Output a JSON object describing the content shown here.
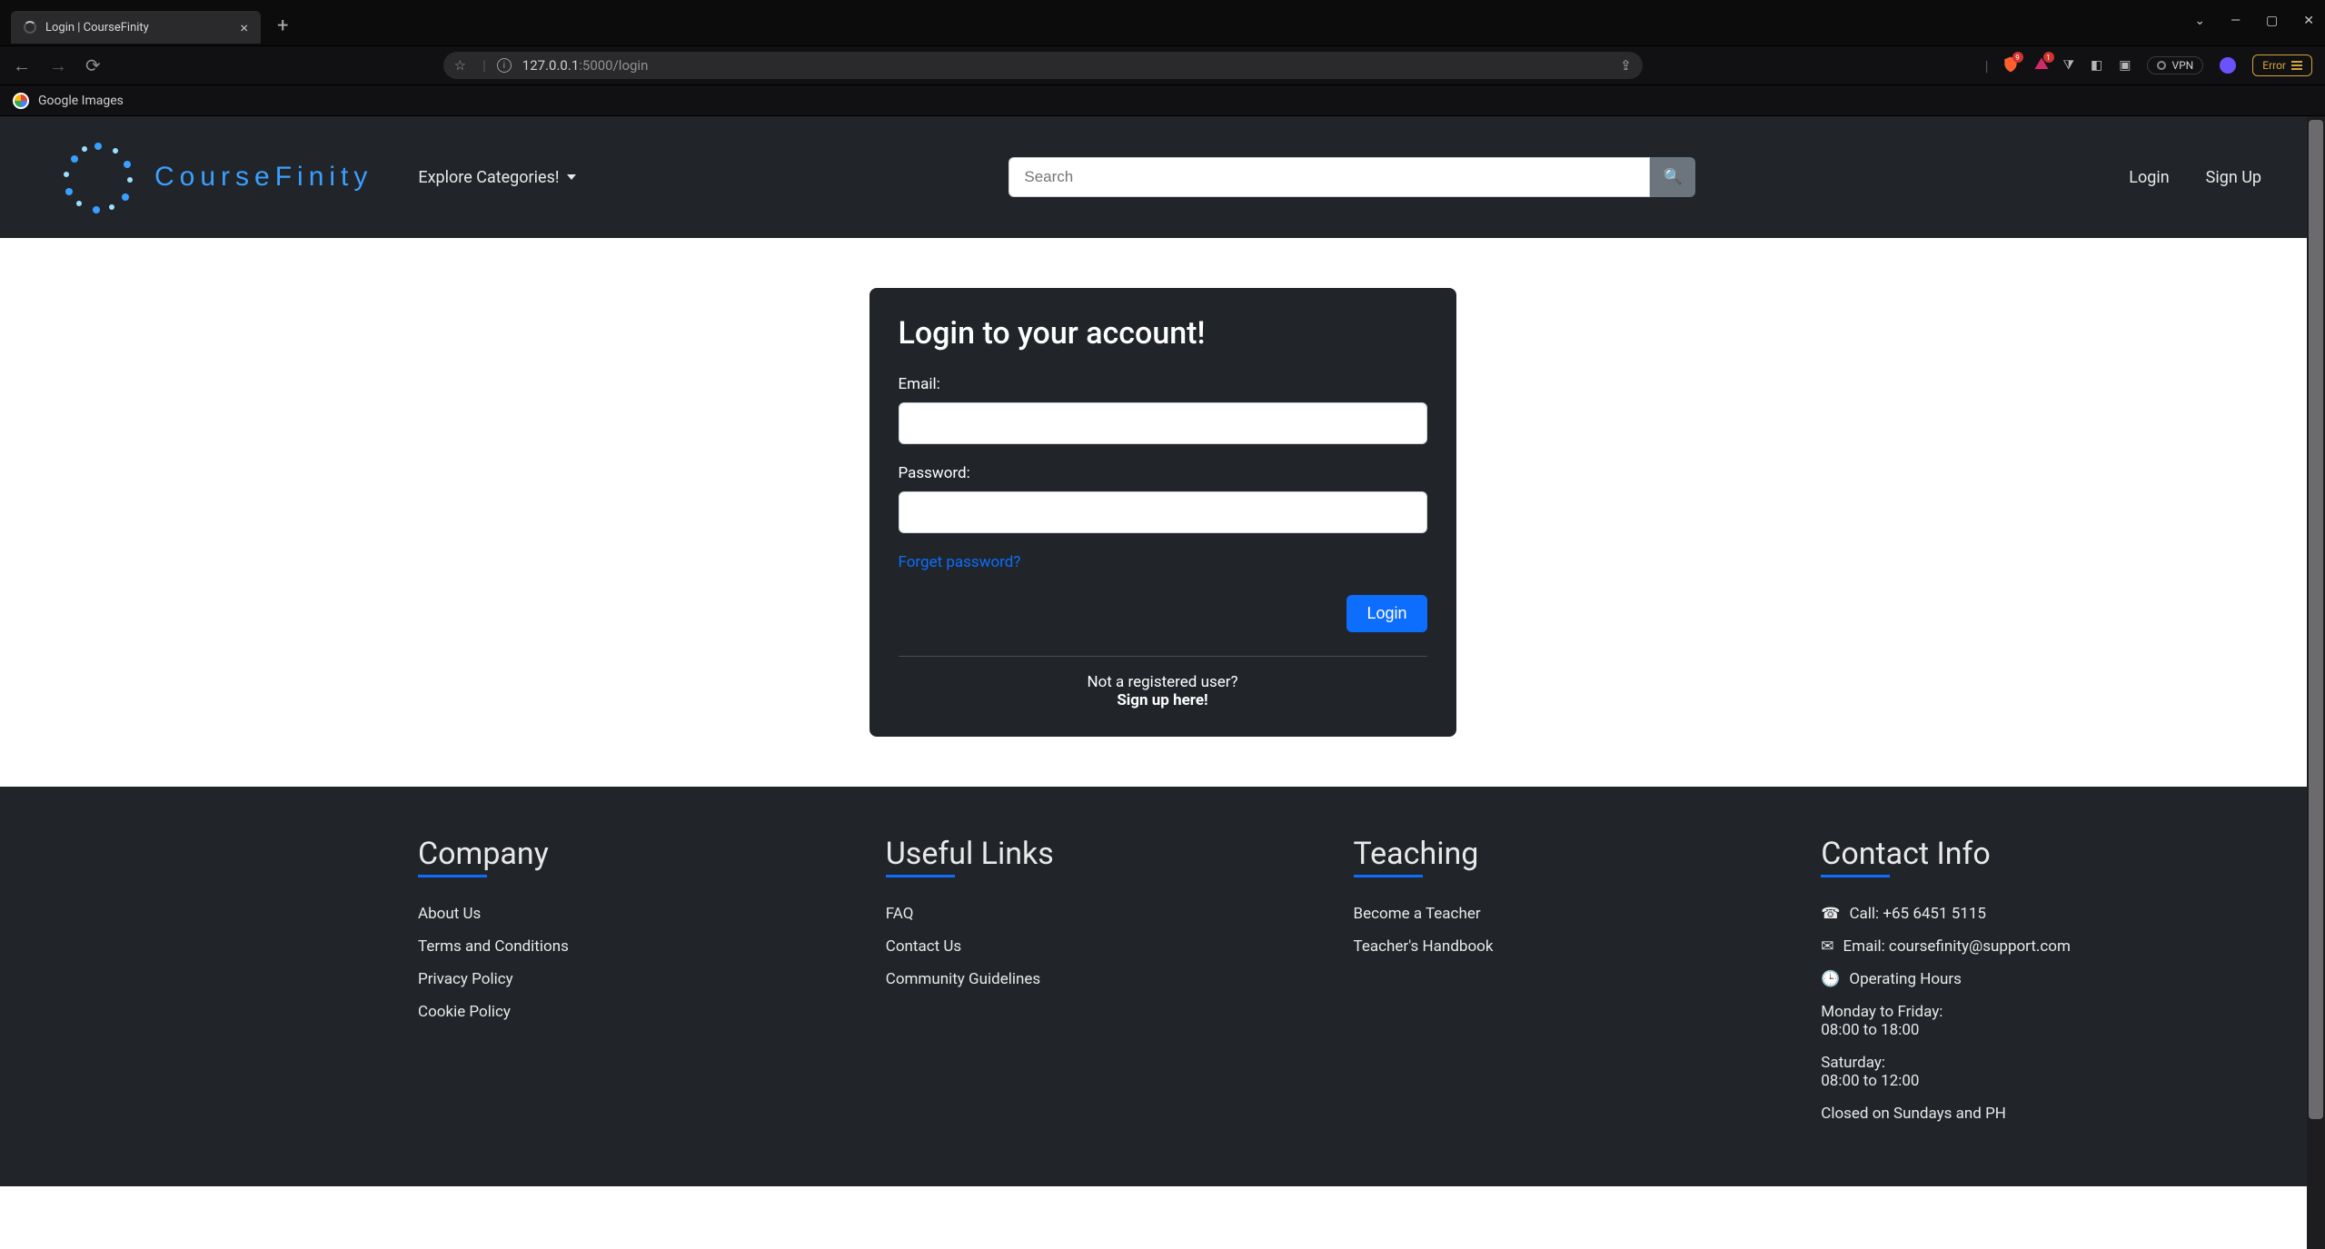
{
  "browser": {
    "tab_title": "Login | CourseFinity",
    "url_host": "127.0.0.1",
    "url_port_path": ":5000/login",
    "bookmark": "Google Images",
    "shields_count": "9",
    "notif_count": "1",
    "vpn_label": "VPN",
    "error_label": "Error"
  },
  "nav": {
    "brand": "CourseFinity",
    "explore": "Explore Categories!",
    "search_placeholder": "Search",
    "login": "Login",
    "signup": "Sign Up"
  },
  "login": {
    "heading": "Login to your account!",
    "email_label": "Email:",
    "password_label": "Password:",
    "forgot": "Forget password?",
    "submit": "Login",
    "not_registered": "Not a registered user?",
    "signup_here": "Sign up here!"
  },
  "footer": {
    "company": {
      "title": "Company",
      "items": [
        "About Us",
        "Terms and Conditions",
        "Privacy Policy",
        "Cookie Policy"
      ]
    },
    "useful": {
      "title": "Useful Links",
      "items": [
        "FAQ",
        "Contact Us",
        "Community Guidelines"
      ]
    },
    "teaching": {
      "title": "Teaching",
      "items": [
        "Become a Teacher",
        "Teacher's Handbook"
      ]
    },
    "contact": {
      "title": "Contact Info",
      "call": "Call: +65 6451 5115",
      "email": "Email: coursefinity@support.com",
      "hours_label": "Operating Hours",
      "mon_fri": "Monday to Friday:",
      "mon_fri_h": "08:00 to 18:00",
      "sat": "Saturday:",
      "sat_h": "08:00 to 12:00",
      "closed": "Closed on Sundays and PH"
    }
  }
}
